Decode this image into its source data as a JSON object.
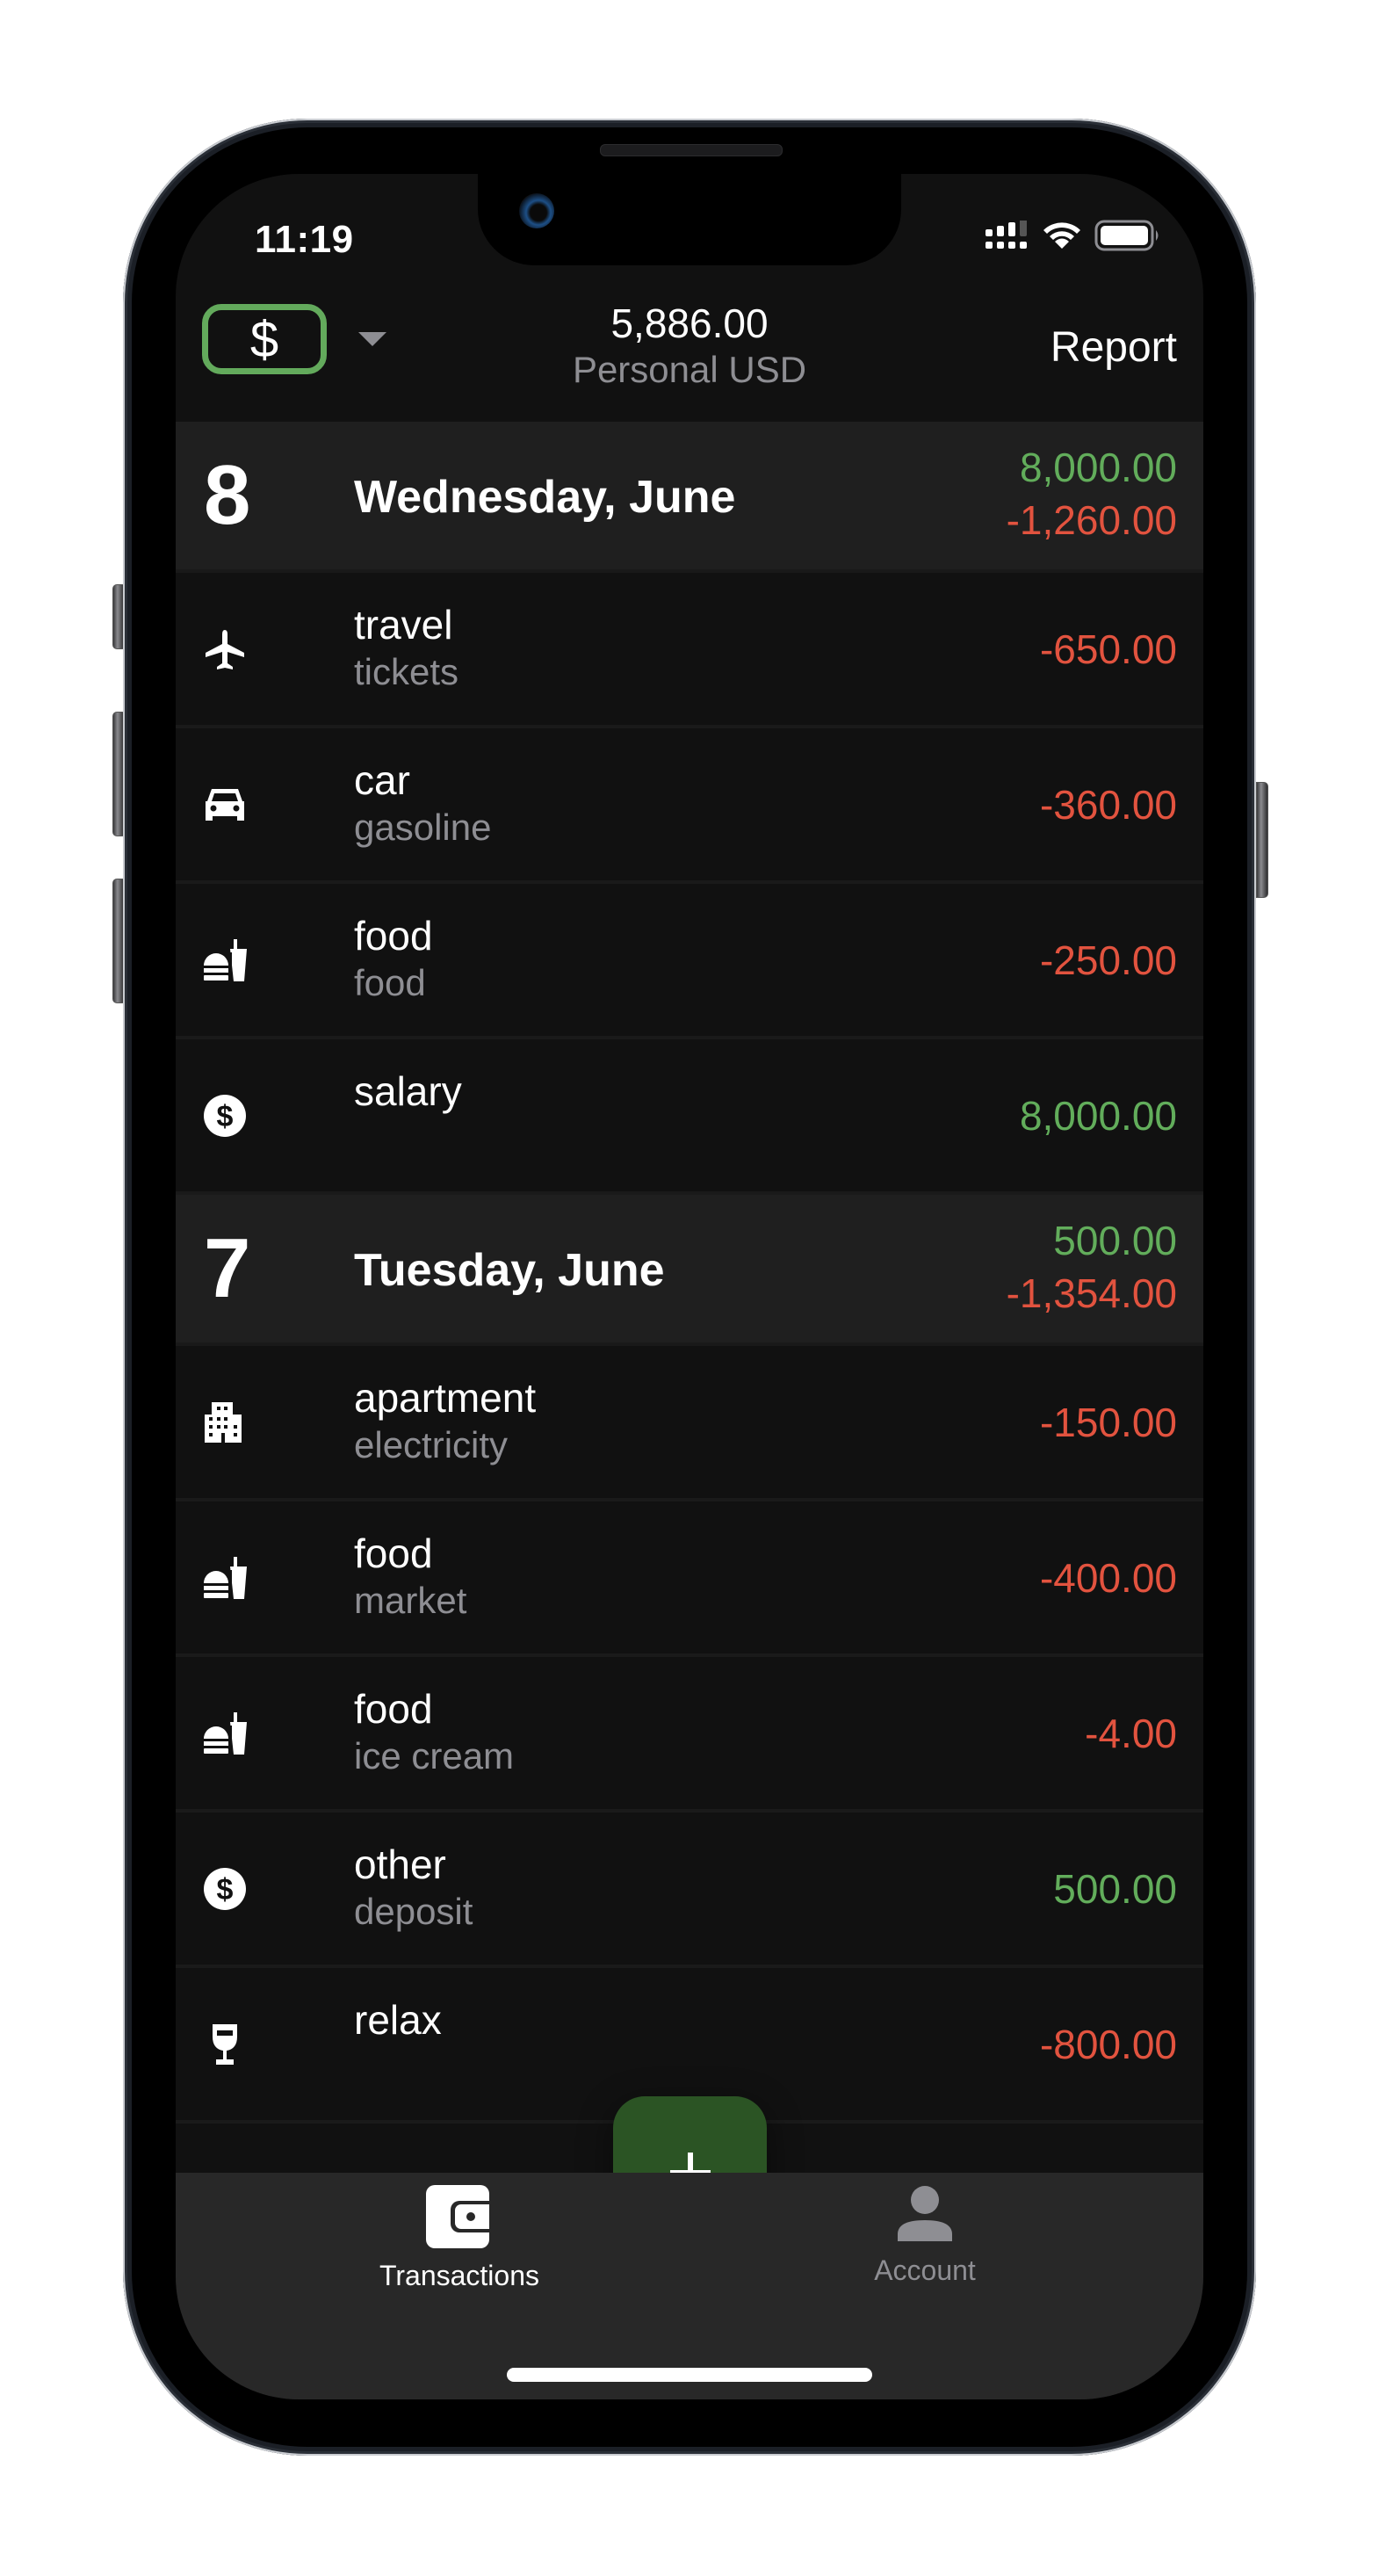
{
  "status_bar": {
    "time": "11:19",
    "icons": [
      "cellular-signal-icon",
      "wifi-icon",
      "battery-icon"
    ]
  },
  "header": {
    "currency_symbol": "$",
    "currency_dropdown_icon": "caret-down-icon",
    "balance": "5,886.00",
    "account_name": "Personal USD",
    "report_label": "Report"
  },
  "colors": {
    "income": "#62ad5b",
    "expense": "#e2533f",
    "accent": "#63aa5c",
    "fab": "#2b5424"
  },
  "days": [
    {
      "day_number": "8",
      "label": "Wednesday, June",
      "income_total": "8,000.00",
      "expense_total": "-1,260.00",
      "transactions": [
        {
          "icon": "airplane-icon",
          "category": "travel",
          "note": "tickets",
          "amount": "-650.00",
          "type": "expense"
        },
        {
          "icon": "car-icon",
          "category": "car",
          "note": "gasoline",
          "amount": "-360.00",
          "type": "expense"
        },
        {
          "icon": "fastfood-icon",
          "category": "food",
          "note": "food",
          "amount": "-250.00",
          "type": "expense"
        },
        {
          "icon": "dollar-circle-icon",
          "category": "salary",
          "note": "",
          "amount": "8,000.00",
          "type": "income"
        }
      ]
    },
    {
      "day_number": "7",
      "label": "Tuesday, June",
      "income_total": "500.00",
      "expense_total": "-1,354.00",
      "transactions": [
        {
          "icon": "building-icon",
          "category": "apartment",
          "note": "electricity",
          "amount": "-150.00",
          "type": "expense"
        },
        {
          "icon": "fastfood-icon",
          "category": "food",
          "note": "market",
          "amount": "-400.00",
          "type": "expense"
        },
        {
          "icon": "fastfood-icon",
          "category": "food",
          "note": "ice cream",
          "amount": "-4.00",
          "type": "expense"
        },
        {
          "icon": "dollar-circle-icon",
          "category": "other",
          "note": "deposit",
          "amount": "500.00",
          "type": "income"
        },
        {
          "icon": "wine-glass-icon",
          "category": "relax",
          "note": "",
          "amount": "-800.00",
          "type": "expense"
        }
      ]
    }
  ],
  "fab": {
    "icon": "plus-icon"
  },
  "tabs": [
    {
      "label": "Transactions",
      "icon": "wallet-icon",
      "active": true
    },
    {
      "label": "Account",
      "icon": "person-icon",
      "active": false
    }
  ]
}
